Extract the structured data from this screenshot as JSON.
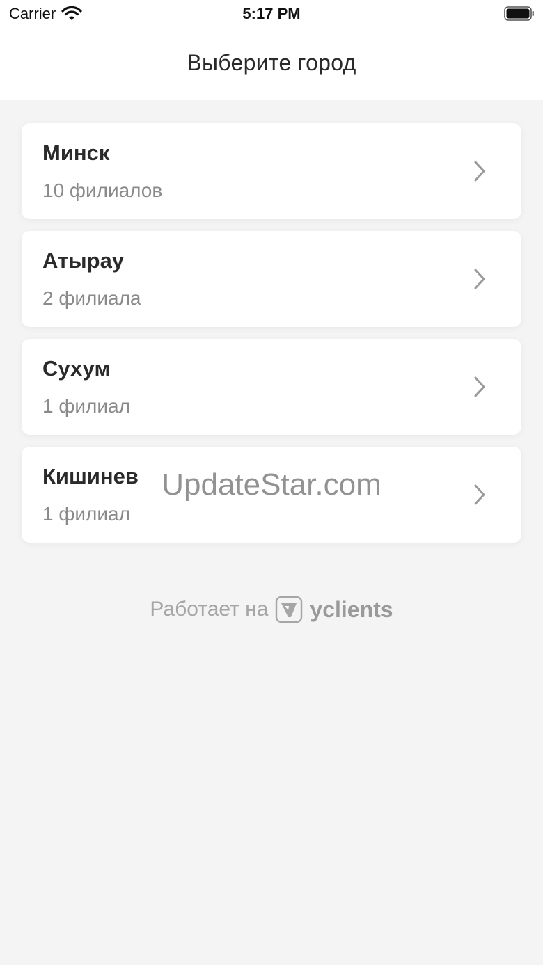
{
  "status_bar": {
    "carrier": "Carrier",
    "time": "5:17 PM",
    "wifi_icon": "wifi-icon",
    "battery_icon": "battery-icon"
  },
  "header": {
    "title": "Выберите город"
  },
  "cities": [
    {
      "name": "Минск",
      "branches": "10 филиалов"
    },
    {
      "name": "Атырау",
      "branches": "2 филиала"
    },
    {
      "name": "Сухум",
      "branches": "1 филиал"
    },
    {
      "name": "Кишинев",
      "branches": "1 филиал"
    }
  ],
  "watermark": "UpdateStar.com",
  "footer": {
    "powered_by": "Работает на",
    "brand": "yclients",
    "logo_icon": "yclients-logo-icon"
  },
  "colors": {
    "background": "#f4f4f4",
    "card": "#ffffff",
    "title_text": "#2a2a2a",
    "secondary_text": "#8a8a8a",
    "chevron": "#9a9a9a"
  }
}
